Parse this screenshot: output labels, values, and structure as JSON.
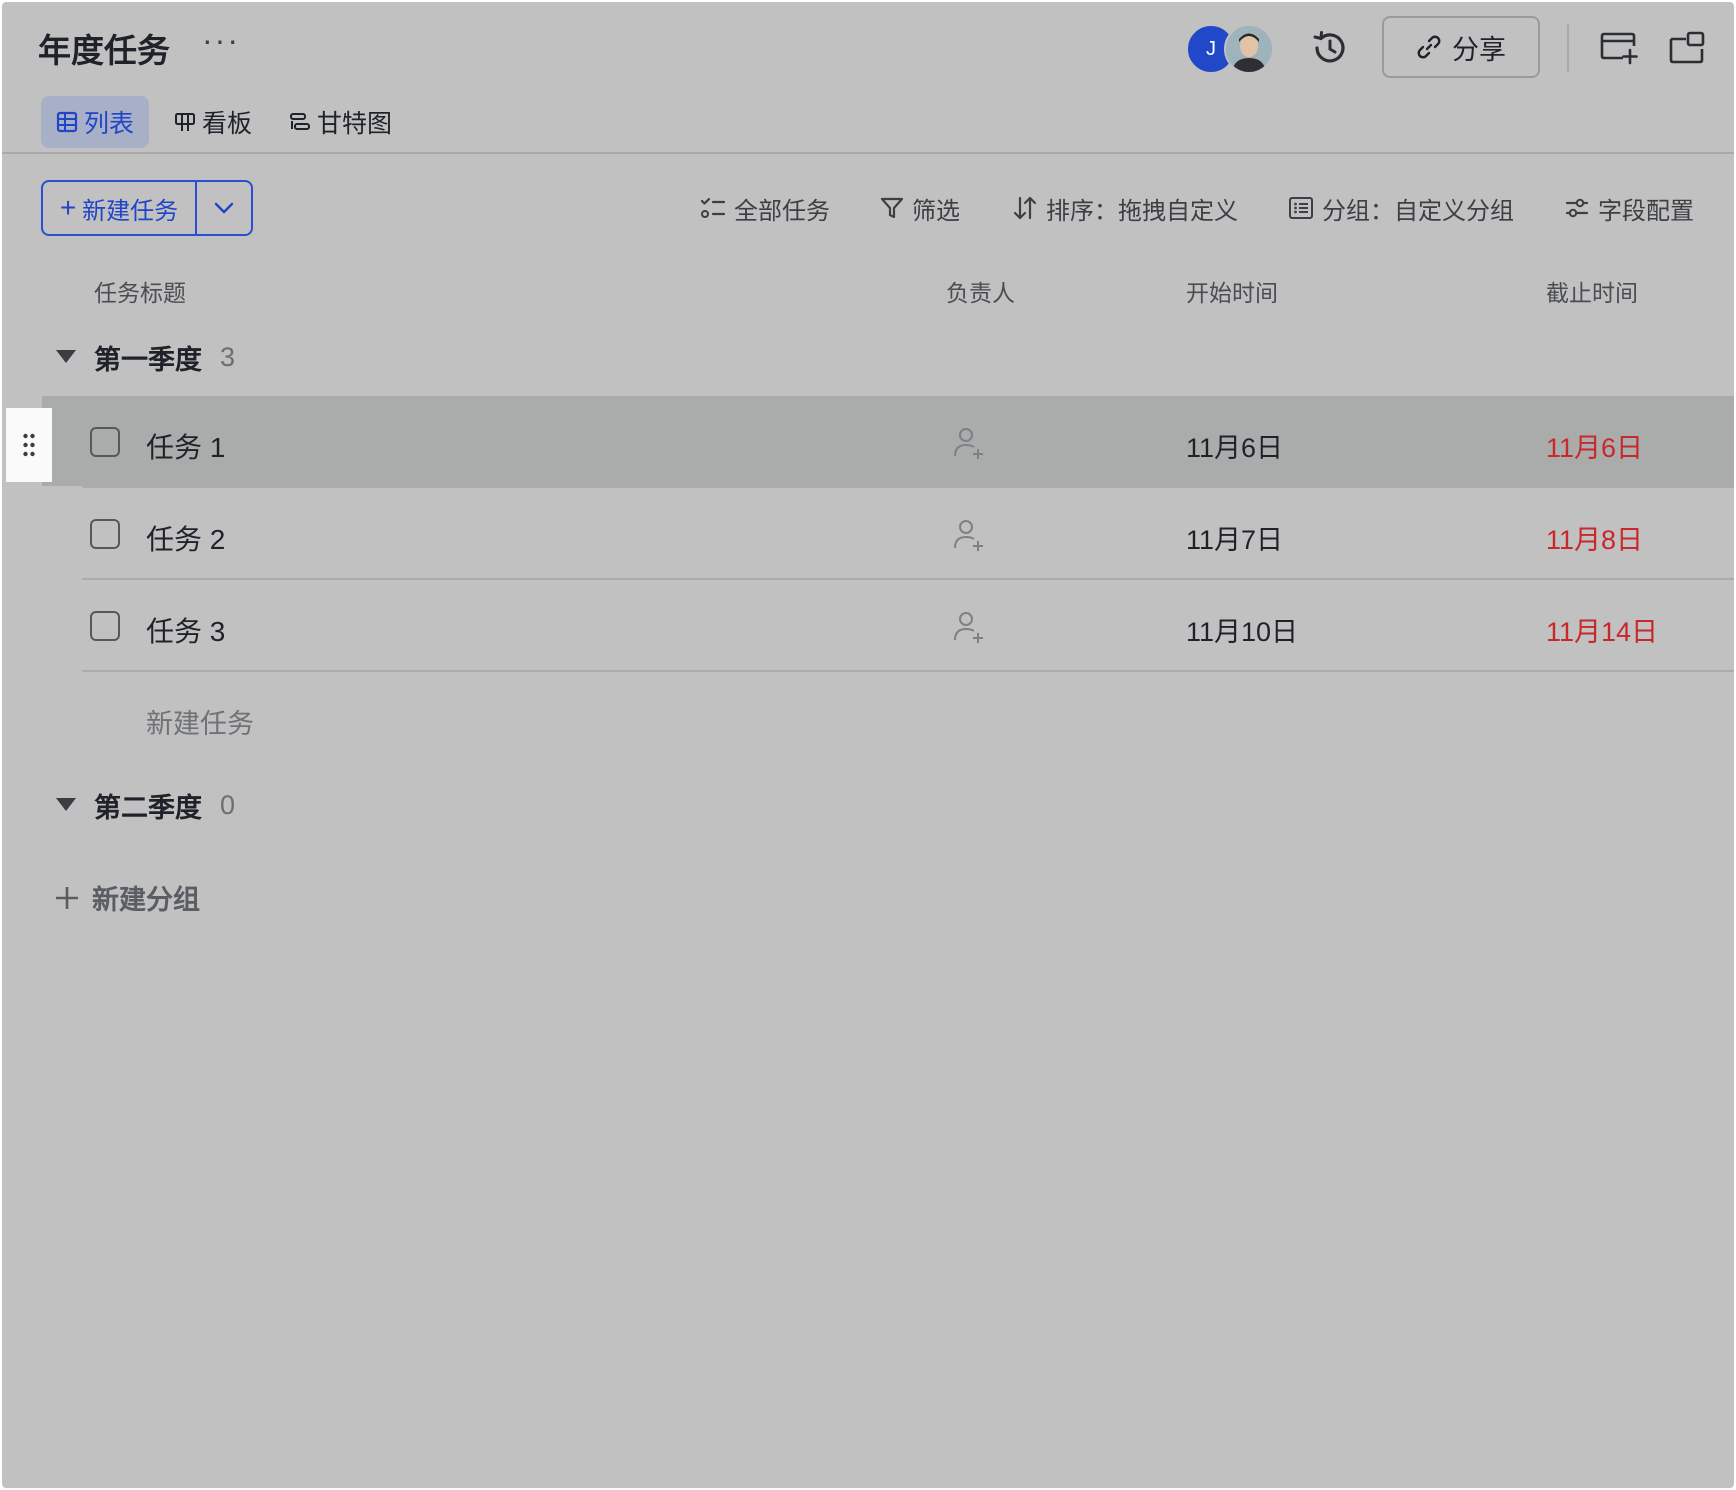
{
  "header": {
    "title": "年度任务",
    "more_label": "···",
    "avatar_initial": "J",
    "share_label": "分享"
  },
  "tabs": [
    {
      "label": "列表",
      "icon": "table-icon",
      "active": true
    },
    {
      "label": "看板",
      "icon": "kanban-icon",
      "active": false
    },
    {
      "label": "甘特图",
      "icon": "gantt-icon",
      "active": false
    }
  ],
  "toolbar": {
    "new_task_label": "新建任务",
    "all_tasks_label": "全部任务",
    "filter_label": "筛选",
    "sort_label": "排序：拖拽自定义",
    "group_label": "分组：自定义分组",
    "fields_label": "字段配置"
  },
  "columns": {
    "title": "任务标题",
    "assignee": "负责人",
    "start": "开始时间",
    "due": "截止时间"
  },
  "groups": [
    {
      "name": "第一季度",
      "count": "3",
      "tasks": [
        {
          "title": "任务 1",
          "start": "11月6日",
          "due": "11月6日"
        },
        {
          "title": "任务 2",
          "start": "11月7日",
          "due": "11月8日"
        },
        {
          "title": "任务 3",
          "start": "11月10日",
          "due": "11月14日"
        }
      ],
      "add_task_label": "新建任务"
    },
    {
      "name": "第二季度",
      "count": "0",
      "tasks": []
    }
  ],
  "add_group_label": "新建分组",
  "colors": {
    "accent": "#2045c8",
    "overdue": "#c8282a",
    "background": "#c1c1c1"
  }
}
